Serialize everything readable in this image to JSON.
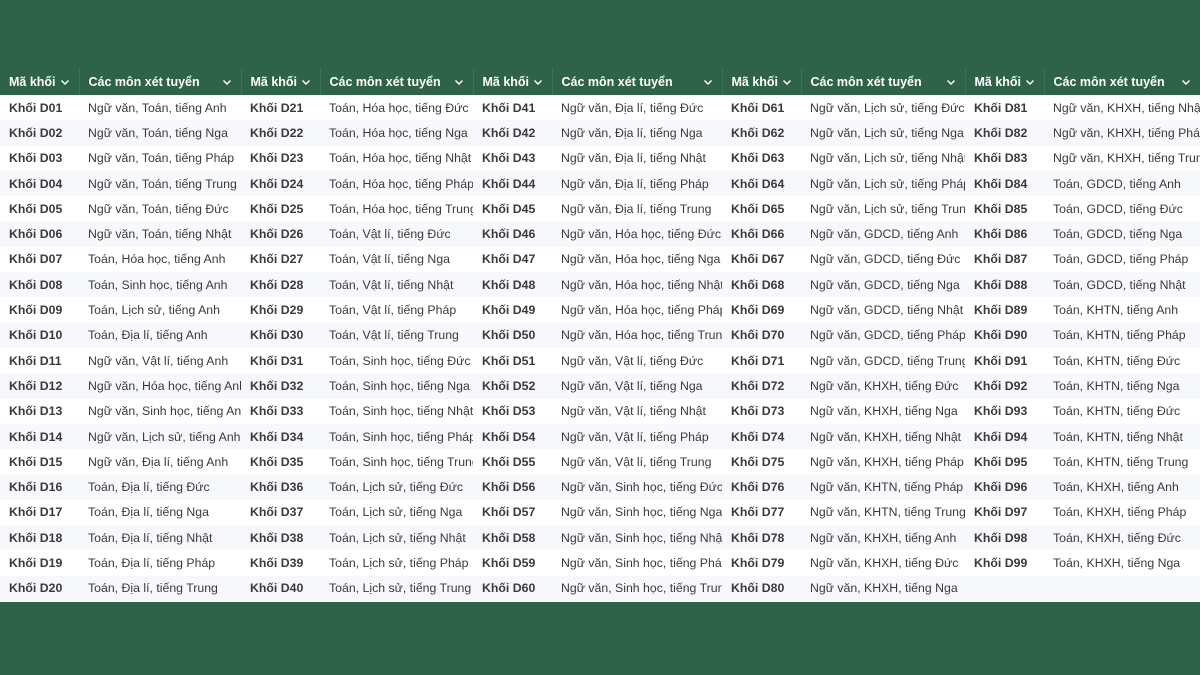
{
  "header": {
    "code_label": "Mã khối",
    "subject_label": "Các môn xét tuyển"
  },
  "columns": [
    {
      "rows": [
        {
          "code": "Khối D01",
          "subjects": "Ngữ văn, Toán, tiếng Anh"
        },
        {
          "code": "Khối D02",
          "subjects": "Ngữ văn, Toán, tiếng Nga"
        },
        {
          "code": "Khối D03",
          "subjects": "Ngữ văn, Toán, tiếng Pháp"
        },
        {
          "code": "Khối D04",
          "subjects": "Ngữ văn, Toán, tiếng Trung"
        },
        {
          "code": "Khối D05",
          "subjects": "Ngữ văn, Toán, tiếng Đức"
        },
        {
          "code": "Khối D06",
          "subjects": "Ngữ văn, Toán, tiếng Nhật"
        },
        {
          "code": "Khối D07",
          "subjects": "Toán, Hóa học, tiếng Anh"
        },
        {
          "code": "Khối D08",
          "subjects": "Toán, Sinh học, tiếng Anh"
        },
        {
          "code": "Khối D09",
          "subjects": "Toán, Lịch sử, tiếng Anh"
        },
        {
          "code": "Khối D10",
          "subjects": "Toán, Địa lí, tiếng Anh"
        },
        {
          "code": "Khối D11",
          "subjects": "Ngữ văn, Vật lí, tiếng Anh"
        },
        {
          "code": "Khối D12",
          "subjects": "Ngữ văn, Hóa học, tiếng Anh"
        },
        {
          "code": "Khối D13",
          "subjects": "Ngữ văn, Sinh học, tiếng Anh"
        },
        {
          "code": "Khối D14",
          "subjects": "Ngữ văn, Lịch sử, tiếng Anh"
        },
        {
          "code": "Khối D15",
          "subjects": "Ngữ văn, Địa lí, tiếng Anh"
        },
        {
          "code": "Khối D16",
          "subjects": "Toán, Địa lí, tiếng Đức"
        },
        {
          "code": "Khối D17",
          "subjects": "Toán, Địa lí, tiếng Nga"
        },
        {
          "code": "Khối D18",
          "subjects": "Toán, Địa lí, tiếng Nhật"
        },
        {
          "code": "Khối D19",
          "subjects": "Toán, Địa lí, tiếng Pháp"
        },
        {
          "code": "Khối D20",
          "subjects": "Toán, Địa lí, tiếng Trung"
        }
      ]
    },
    {
      "rows": [
        {
          "code": "Khối D21",
          "subjects": "Toán, Hóa học, tiếng Đức"
        },
        {
          "code": "Khối D22",
          "subjects": "Toán, Hóa học, tiếng Nga"
        },
        {
          "code": "Khối D23",
          "subjects": "Toán, Hóa học, tiếng Nhật"
        },
        {
          "code": "Khối D24",
          "subjects": "Toán, Hóa học, tiếng Pháp"
        },
        {
          "code": "Khối D25",
          "subjects": "Toán, Hóa học, tiếng Trung"
        },
        {
          "code": "Khối D26",
          "subjects": "Toán, Vật lí, tiếng Đức"
        },
        {
          "code": "Khối D27",
          "subjects": "Toán, Vật lí, tiếng Nga"
        },
        {
          "code": "Khối D28",
          "subjects": "Toán, Vật lí, tiếng Nhật"
        },
        {
          "code": "Khối D29",
          "subjects": "Toán, Vật lí, tiếng Pháp"
        },
        {
          "code": "Khối D30",
          "subjects": "Toán, Vật lí, tiếng Trung"
        },
        {
          "code": "Khối D31",
          "subjects": "Toán, Sinh học, tiếng Đức"
        },
        {
          "code": "Khối D32",
          "subjects": "Toán, Sinh học, tiếng Nga"
        },
        {
          "code": "Khối D33",
          "subjects": "Toán, Sinh học, tiếng Nhật"
        },
        {
          "code": "Khối D34",
          "subjects": "Toán, Sinh học, tiếng Pháp"
        },
        {
          "code": "Khối D35",
          "subjects": "Toán, Sinh học, tiếng Trung"
        },
        {
          "code": "Khối D36",
          "subjects": "Toán, Lịch sử, tiếng Đức"
        },
        {
          "code": "Khối D37",
          "subjects": "Toán, Lịch sử, tiếng Nga"
        },
        {
          "code": "Khối D38",
          "subjects": "Toán, Lịch sử, tiếng Nhật"
        },
        {
          "code": "Khối D39",
          "subjects": "Toán, Lịch sử, tiếng Pháp"
        },
        {
          "code": "Khối D40",
          "subjects": "Toán, Lịch sử, tiếng Trung"
        }
      ]
    },
    {
      "rows": [
        {
          "code": "Khối D41",
          "subjects": "Ngữ văn, Địa lí, tiếng Đức"
        },
        {
          "code": "Khối D42",
          "subjects": "Ngữ văn, Địa lí, tiếng Nga"
        },
        {
          "code": "Khối D43",
          "subjects": "Ngữ văn, Địa lí, tiếng Nhật"
        },
        {
          "code": "Khối D44",
          "subjects": "Ngữ văn, Địa lí, tiếng Pháp"
        },
        {
          "code": "Khối D45",
          "subjects": "Ngữ văn, Địa lí, tiếng Trung"
        },
        {
          "code": "Khối D46",
          "subjects": "Ngữ văn, Hóa học, tiếng Đức"
        },
        {
          "code": "Khối D47",
          "subjects": "Ngữ văn, Hóa học, tiếng Nga"
        },
        {
          "code": "Khối D48",
          "subjects": "Ngữ văn, Hóa học, tiếng Nhật"
        },
        {
          "code": "Khối D49",
          "subjects": "Ngữ văn, Hóa học, tiếng Pháp"
        },
        {
          "code": "Khối D50",
          "subjects": "Ngữ văn, Hóa học, tiếng Trung"
        },
        {
          "code": "Khối D51",
          "subjects": "Ngữ văn, Vật lí, tiếng Đức"
        },
        {
          "code": "Khối D52",
          "subjects": "Ngữ văn, Vật lí, tiếng Nga"
        },
        {
          "code": "Khối D53",
          "subjects": "Ngữ văn, Vật lí, tiếng Nhật"
        },
        {
          "code": "Khối D54",
          "subjects": "Ngữ văn, Vật lí, tiếng Pháp"
        },
        {
          "code": "Khối D55",
          "subjects": "Ngữ văn, Vật lí, tiếng Trung"
        },
        {
          "code": "Khối D56",
          "subjects": "Ngữ văn, Sinh học, tiếng Đức"
        },
        {
          "code": "Khối D57",
          "subjects": "Ngữ văn, Sinh học, tiếng Nga"
        },
        {
          "code": "Khối D58",
          "subjects": "Ngữ văn, Sinh học, tiếng Nhật"
        },
        {
          "code": "Khối D59",
          "subjects": "Ngữ văn, Sinh học, tiếng Pháp"
        },
        {
          "code": "Khối D60",
          "subjects": "Ngữ văn, Sinh học, tiếng Trung"
        }
      ]
    },
    {
      "rows": [
        {
          "code": "Khối D61",
          "subjects": "Ngữ văn, Lịch sử, tiếng Đức"
        },
        {
          "code": "Khối D62",
          "subjects": "Ngữ văn, Lịch sử, tiếng Nga"
        },
        {
          "code": "Khối D63",
          "subjects": "Ngữ văn, Lịch sử, tiếng Nhật"
        },
        {
          "code": "Khối D64",
          "subjects": "Ngữ văn, Lịch sử, tiếng Pháp"
        },
        {
          "code": "Khối D65",
          "subjects": "Ngữ văn, Lịch sử, tiếng Trung"
        },
        {
          "code": "Khối D66",
          "subjects": "Ngữ văn, GDCD, tiếng Anh"
        },
        {
          "code": "Khối D67",
          "subjects": "Ngữ văn, GDCD, tiếng Đức"
        },
        {
          "code": "Khối D68",
          "subjects": "Ngữ văn, GDCD, tiếng Nga"
        },
        {
          "code": "Khối D69",
          "subjects": "Ngữ văn, GDCD, tiếng Nhật"
        },
        {
          "code": "Khối D70",
          "subjects": "Ngữ văn, GDCD, tiếng Pháp"
        },
        {
          "code": "Khối D71",
          "subjects": "Ngữ văn, GDCD, tiếng Trung"
        },
        {
          "code": "Khối D72",
          "subjects": "Ngữ văn, KHXH, tiếng Đức"
        },
        {
          "code": "Khối D73",
          "subjects": "Ngữ văn, KHXH, tiếng Nga"
        },
        {
          "code": "Khối D74",
          "subjects": "Ngữ văn, KHXH, tiếng Nhật"
        },
        {
          "code": "Khối D75",
          "subjects": "Ngữ văn, KHXH, tiếng Pháp"
        },
        {
          "code": "Khối D76",
          "subjects": "Ngữ văn, KHTN, tiếng Pháp"
        },
        {
          "code": "Khối D77",
          "subjects": "Ngữ văn, KHTN, tiếng Trung"
        },
        {
          "code": "Khối D78",
          "subjects": "Ngữ văn, KHXH, tiếng Anh"
        },
        {
          "code": "Khối D79",
          "subjects": "Ngữ văn, KHXH, tiếng Đức"
        },
        {
          "code": "Khối D80",
          "subjects": "Ngữ văn, KHXH, tiếng Nga"
        }
      ]
    },
    {
      "rows": [
        {
          "code": "Khối D81",
          "subjects": "Ngữ văn, KHXH, tiếng Nhật"
        },
        {
          "code": "Khối D82",
          "subjects": "Ngữ văn, KHXH, tiếng Pháp"
        },
        {
          "code": "Khối D83",
          "subjects": "Ngữ văn, KHXH, tiếng Trung"
        },
        {
          "code": "Khối D84",
          "subjects": "Toán, GDCD, tiếng Anh"
        },
        {
          "code": "Khối D85",
          "subjects": "Toán, GDCD, tiếng Đức"
        },
        {
          "code": "Khối D86",
          "subjects": "Toán, GDCD, tiếng Nga"
        },
        {
          "code": "Khối D87",
          "subjects": "Toán, GDCD, tiếng Pháp"
        },
        {
          "code": "Khối D88",
          "subjects": "Toán, GDCD, tiếng Nhật"
        },
        {
          "code": "Khối D89",
          "subjects": "Toán, KHTN, tiếng Anh"
        },
        {
          "code": "Khối D90",
          "subjects": "Toán, KHTN, tiếng Pháp"
        },
        {
          "code": "Khối D91",
          "subjects": "Toán, KHTN, tiếng Đức"
        },
        {
          "code": "Khối D92",
          "subjects": "Toán, KHTN, tiếng Nga"
        },
        {
          "code": "Khối D93",
          "subjects": "Toán, KHTN, tiếng Đức"
        },
        {
          "code": "Khối D94",
          "subjects": "Toán, KHTN, tiếng Nhật"
        },
        {
          "code": "Khối D95",
          "subjects": "Toán, KHTN, tiếng Trung"
        },
        {
          "code": "Khối D96",
          "subjects": "Toán, KHXH, tiếng Anh"
        },
        {
          "code": "Khối D97",
          "subjects": "Toán, KHXH, tiếng Pháp"
        },
        {
          "code": "Khối D98",
          "subjects": "Toán, KHXH, tiếng Đức"
        },
        {
          "code": "Khối D99",
          "subjects": "Toán, KHXH, tiếng Nga"
        },
        {
          "code": "",
          "subjects": ""
        }
      ]
    }
  ]
}
